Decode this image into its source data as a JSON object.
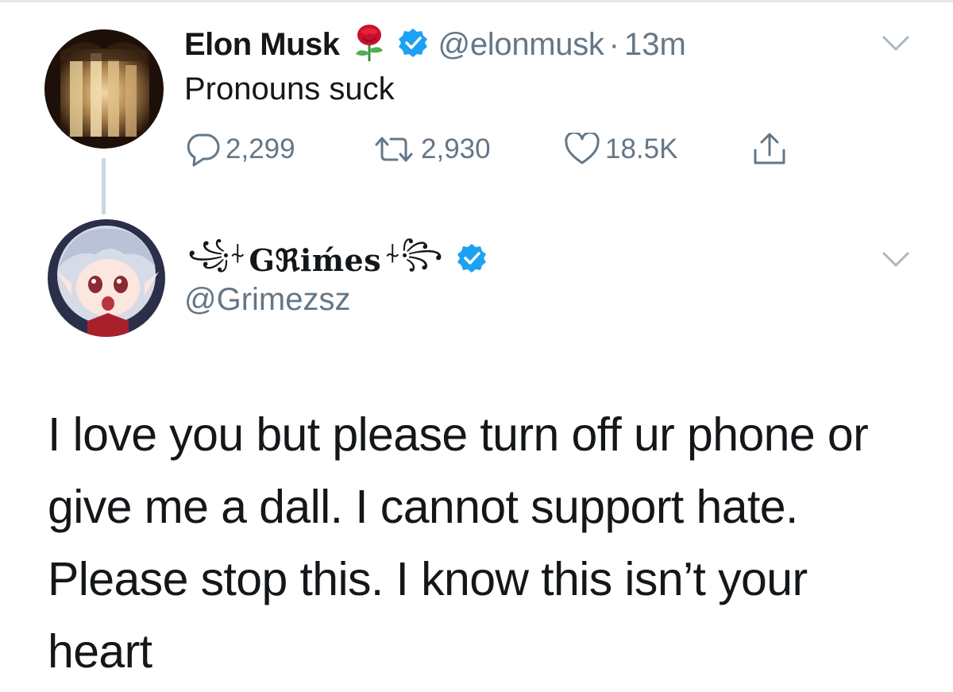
{
  "tweet1": {
    "display_name": "Elon Musk",
    "handle": "@elonmusk",
    "separator": "·",
    "timestamp": "13m",
    "text": "Pronouns suck",
    "reply_count": "2,299",
    "retweet_count": "2,930",
    "like_count": "18.5K"
  },
  "tweet2": {
    "display_name_prefix": "꧁⍭",
    "display_name": "Gℜiḿes",
    "display_name_suffix": "⍭꧂",
    "handle": "@Grimezsz",
    "text_lines": [
      "I love you but please turn off ur phone or",
      "give me a dall.  I cannot support hate.",
      "Please stop this. I know this isn’t your",
      "heart"
    ]
  },
  "icons": {
    "verified": "verified-badge-icon",
    "rose": "rose-emoji-icon",
    "reply": "reply-icon",
    "retweet": "retweet-icon",
    "like": "heart-icon",
    "share": "share-icon",
    "caret": "chevron-down-icon"
  },
  "colors": {
    "text": "#14171a",
    "secondary": "#657786",
    "verified_blue": "#1da1f2",
    "divider": "#ccd6dd"
  }
}
